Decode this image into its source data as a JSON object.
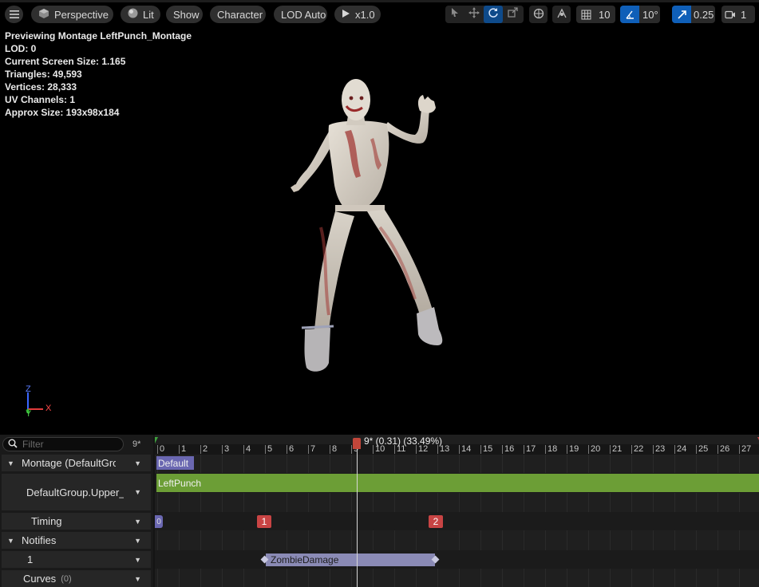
{
  "toolbar": {
    "menu_icon": "hamburger-icon",
    "perspective_label": "Perspective",
    "lit_label": "Lit",
    "show_label": "Show",
    "character_label": "Character",
    "lod_label": "LOD Auto",
    "play_speed_label": "x1.0",
    "grid_snap_value": "10",
    "rotation_snap_value": "10°",
    "scale_snap_value": "0.25",
    "camera_speed_value": "1",
    "accent_color": "#0f5fb8"
  },
  "stats": {
    "preview": "Previewing Montage LeftPunch_Montage",
    "lod": "LOD: 0",
    "screen_size": "Current Screen Size: 1.165",
    "triangles": "Triangles: 49,593",
    "vertices": "Vertices: 28,333",
    "uv_channels": "UV Channels: 1",
    "approx_size": "Approx Size: 193x98x184"
  },
  "axis_gizmo": {
    "z": "Z",
    "y": "Y",
    "x": "X"
  },
  "timeline": {
    "filter_placeholder": "Filter",
    "filter_count": "9*",
    "rows": {
      "montage": "Montage (DefaultGrou",
      "group": "DefaultGroup.Upper_",
      "timing": "Timing",
      "notifies": "Notifies",
      "notify_track": "1",
      "curves": "Curves",
      "curves_count": "(0)"
    },
    "ticks": [
      "0",
      "1",
      "2",
      "3",
      "4",
      "5",
      "6",
      "7",
      "8",
      "9",
      "10",
      "11",
      "12",
      "13",
      "14",
      "15",
      "16",
      "17",
      "18",
      "19",
      "20",
      "21",
      "22",
      "23",
      "24",
      "25",
      "26",
      "27"
    ],
    "scrub_label": "9* (0.31) (33.49%)",
    "section_label": "Default",
    "segment_label": "LeftPunch",
    "timing_markers": [
      "1",
      "2"
    ],
    "notify_label": "ZombieDamage",
    "segment_color": "#6c9e36",
    "section_color": "#6a67b1",
    "notify_color": "#8a8ab5",
    "timing_marker_color": "#c84444"
  }
}
